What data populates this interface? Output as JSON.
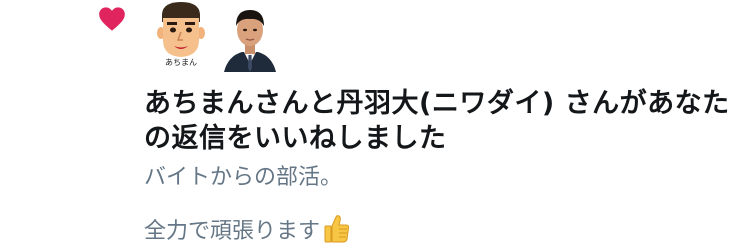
{
  "notification": {
    "mii_caption": "あちまん",
    "text": "あちまんさんと丹羽大(ニワダイ) さんがあなたの返信をいいねしました",
    "tweet_line_1": "バイトからの部活。",
    "tweet_line_2": "全力で頑張ります",
    "emoji_icon": "thumbs-up-icon"
  },
  "colors": {
    "heart": "#e0245e",
    "title_text": "#14171a",
    "secondary_text": "#657786",
    "thumb": "#f6c644"
  }
}
